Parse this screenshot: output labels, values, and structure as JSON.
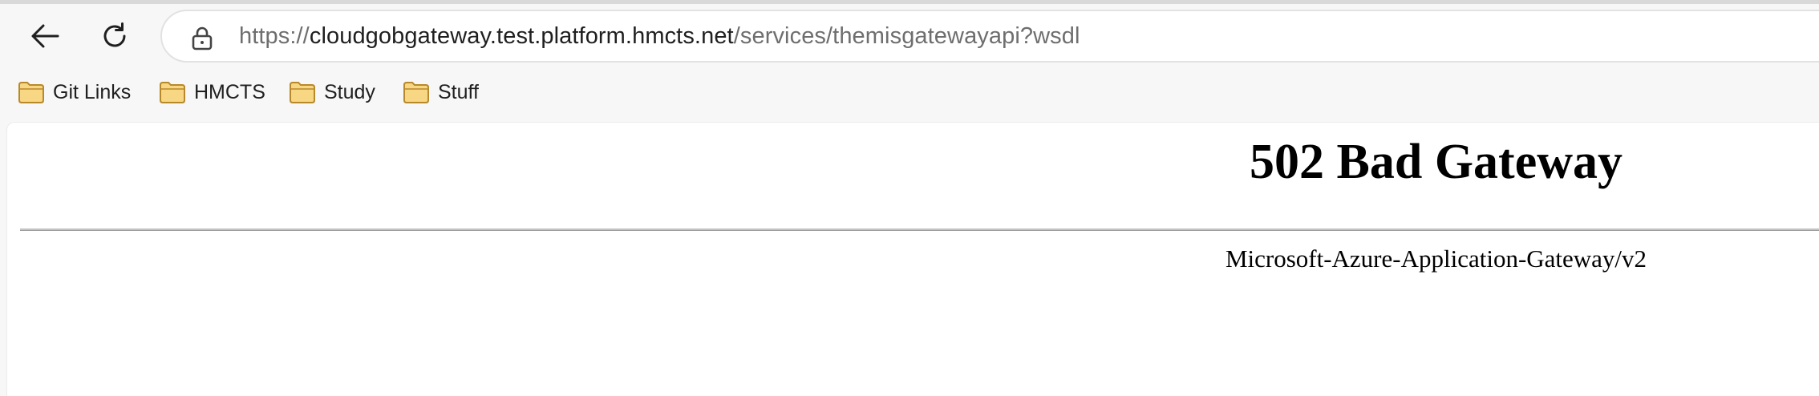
{
  "browser": {
    "url": {
      "scheme": "https://",
      "host": "cloudgobgateway.test.platform.hmcts.net",
      "path": "/services/themisgatewayapi?wsdl"
    },
    "icons": {
      "back": "back-arrow-icon",
      "reload": "reload-icon",
      "lock": "lock-icon",
      "folder": "folder-icon"
    },
    "bookmarks": [
      {
        "label": "Git Links"
      },
      {
        "label": "HMCTS"
      },
      {
        "label": "Study"
      },
      {
        "label": "Stuff"
      }
    ]
  },
  "page": {
    "title": "502 Bad Gateway",
    "server_signature": "Microsoft-Azure-Application-Gateway/v2"
  },
  "colors": {
    "folder_fill": "#f7d784",
    "folder_stroke": "#b8892a",
    "chrome_background": "#f7f7f7",
    "page_background": "#ffffff"
  }
}
